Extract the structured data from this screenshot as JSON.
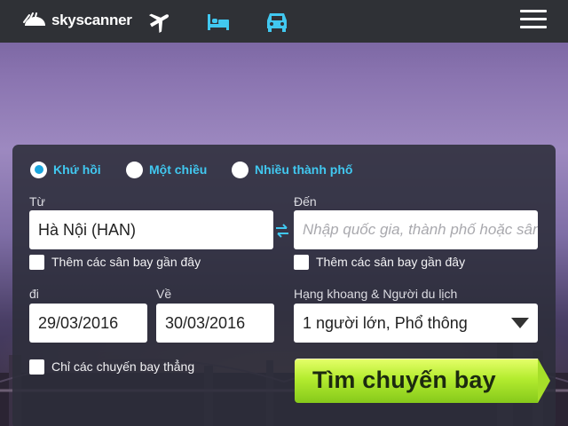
{
  "brand": {
    "name": "skyscanner"
  },
  "nav": {
    "icons": [
      "airplane-icon",
      "bed-icon",
      "car-icon",
      "menu-icon"
    ],
    "active_color": "#41c8f0"
  },
  "trip_type": {
    "options": [
      {
        "label": "Khứ hồi",
        "selected": true
      },
      {
        "label": "Một chiều",
        "selected": false
      },
      {
        "label": "Nhiều thành phố",
        "selected": false
      }
    ]
  },
  "origin": {
    "label": "Từ",
    "value": "Hà Nội (HAN)",
    "nearby_label": "Thêm các sân bay gần đây"
  },
  "destination": {
    "label": "Đến",
    "placeholder": "Nhập quốc gia, thành phố hoặc sân bay",
    "nearby_label": "Thêm các sân bay gần đây"
  },
  "depart": {
    "label": "đi",
    "value": "29/03/2016"
  },
  "return": {
    "label": "Về",
    "value": "30/03/2016"
  },
  "cabin": {
    "label": "Hạng khoang & Người du lịch",
    "value": "1 người lớn, Phổ thông"
  },
  "direct_only": {
    "label": "Chỉ các chuyến bay thẳng"
  },
  "search_button": {
    "label": "Tìm chuyến bay"
  },
  "colors": {
    "topbar": "#2f3136",
    "accent": "#41c8f0",
    "button": "#b4ec2f"
  }
}
